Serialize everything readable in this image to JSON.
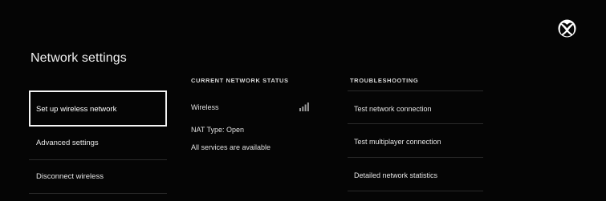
{
  "header": {
    "title": "Network settings",
    "logo_icon": "xbox-logo-icon"
  },
  "menu": {
    "items": [
      {
        "label": "Set up wireless network",
        "focused": true
      },
      {
        "label": "Advanced settings",
        "focused": false
      },
      {
        "label": "Disconnect wireless",
        "focused": false
      }
    ]
  },
  "status": {
    "header": "CURRENT NETWORK STATUS",
    "connection": "Wireless",
    "signal_icon": "signal-bars-icon",
    "nat": "NAT Type: Open",
    "services": "All services are available"
  },
  "troubleshooting": {
    "header": "TROUBLESHOOTING",
    "items": [
      {
        "label": "Test network connection"
      },
      {
        "label": "Test multiplayer connection"
      },
      {
        "label": "Detailed network statistics"
      }
    ]
  },
  "colors": {
    "background": "#050505",
    "text": "#e8e8e8",
    "focus_border": "#f4f4f4",
    "divider": "#2a2a2a"
  }
}
